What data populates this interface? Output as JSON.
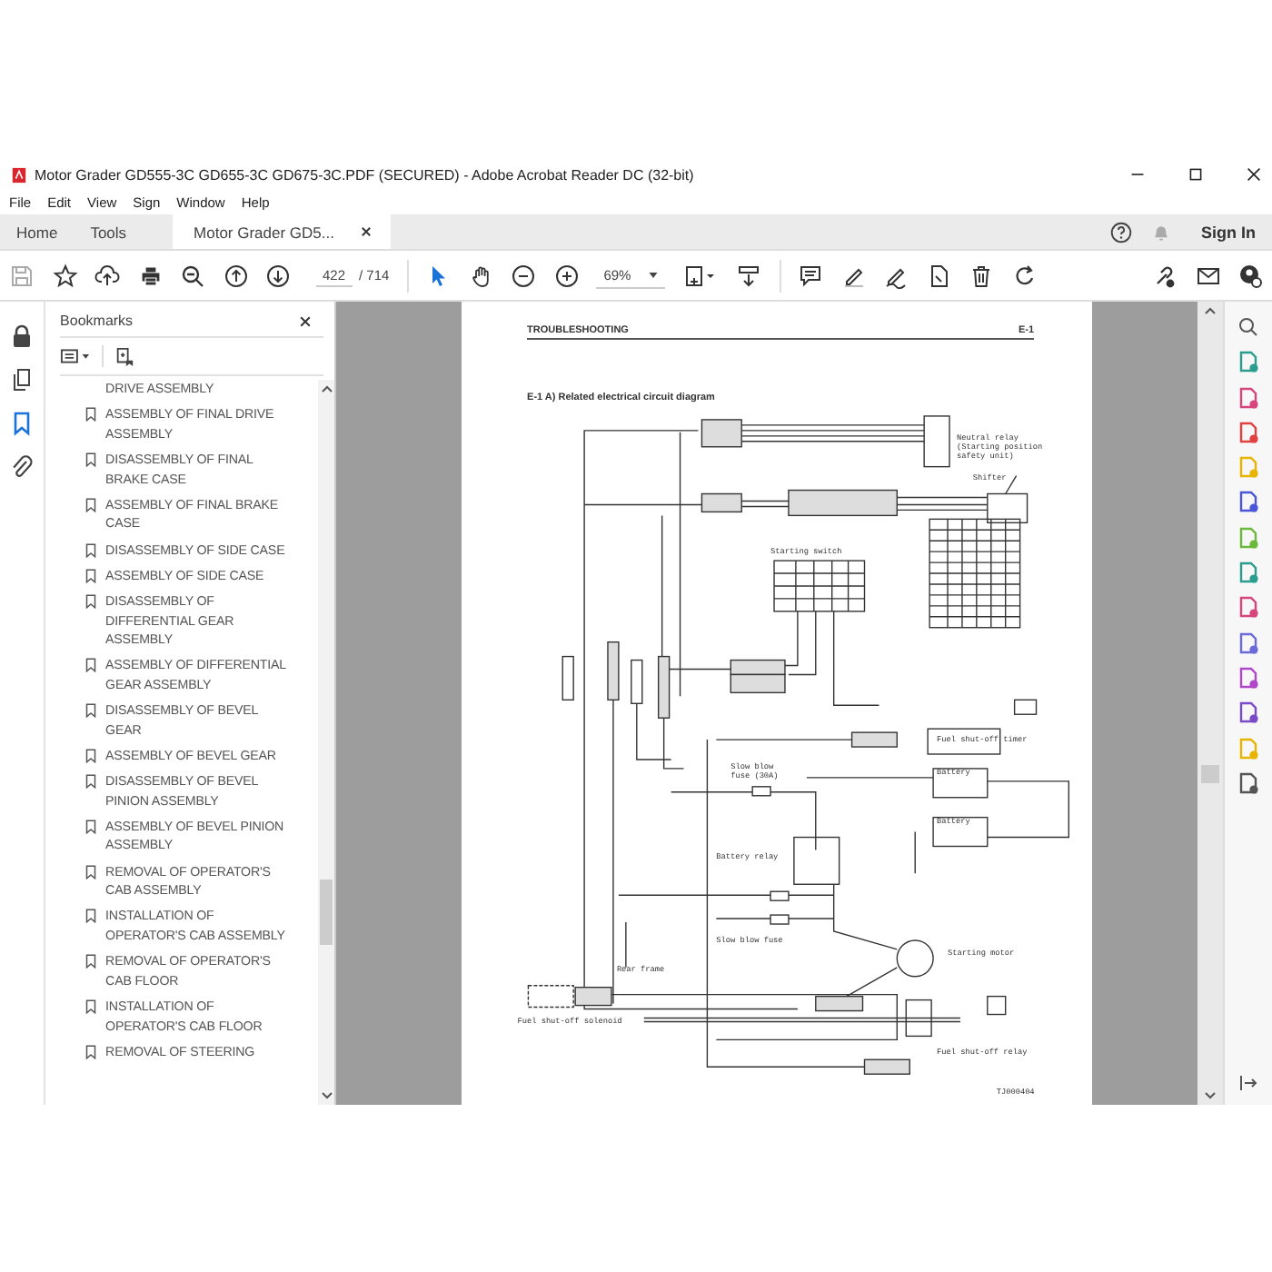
{
  "window": {
    "title": "Motor Grader GD555-3C GD655-3C GD675-3C.PDF (SECURED) - Adobe Acrobat Reader DC (32-bit)"
  },
  "menu": [
    "File",
    "Edit",
    "View",
    "Sign",
    "Window",
    "Help"
  ],
  "tabs": [
    {
      "label": "Home",
      "selected": false,
      "closable": false
    },
    {
      "label": "Tools",
      "selected": false,
      "closable": false
    },
    {
      "label": "Motor Grader GD5...",
      "selected": true,
      "closable": true
    }
  ],
  "account": {
    "sign_in": "Sign In"
  },
  "toolbar": {
    "page_number": "422",
    "page_total": "/ 714",
    "zoom": "69%"
  },
  "side_tools": [
    {
      "kind": "lock",
      "selected": false
    },
    {
      "kind": "pages",
      "selected": false
    },
    {
      "kind": "bookmarks",
      "selected": true
    },
    {
      "kind": "attachments",
      "selected": false
    }
  ],
  "bookmarks": {
    "title": "Bookmarks",
    "items": [
      {
        "label": "DRIVE ASSEMBLY",
        "kind": "continuation"
      },
      {
        "label": "ASSEMBLY OF FINAL DRIVE ASSEMBLY",
        "kind": "bookmark"
      },
      {
        "label": "DISASSEMBLY OF FINAL BRAKE CASE",
        "kind": "bookmark"
      },
      {
        "label": "ASSEMBLY OF FINAL BRAKE CASE",
        "kind": "bookmark"
      },
      {
        "label": "DISASSEMBLY OF SIDE CASE",
        "kind": "bookmark"
      },
      {
        "label": "ASSEMBLY OF SIDE CASE",
        "kind": "bookmark"
      },
      {
        "label": "DISASSEMBLY OF DIFFERENTIAL GEAR ASSEMBLY",
        "kind": "bookmark"
      },
      {
        "label": "ASSEMBLY OF DIFFERENTIAL GEAR ASSEMBLY",
        "kind": "bookmark"
      },
      {
        "label": "DISASSEMBLY OF BEVEL GEAR",
        "kind": "bookmark"
      },
      {
        "label": "ASSEMBLY OF BEVEL GEAR",
        "kind": "bookmark"
      },
      {
        "label": "DISASSEMBLY OF BEVEL PINION ASSEMBLY",
        "kind": "bookmark"
      },
      {
        "label": "ASSEMBLY OF BEVEL PINION ASSEMBLY",
        "kind": "bookmark"
      },
      {
        "label": "REMOVAL OF OPERATOR'S CAB ASSEMBLY",
        "kind": "bookmark"
      },
      {
        "label": "INSTALLATION OF OPERATOR'S CAB ASSEMBLY",
        "kind": "bookmark"
      },
      {
        "label": "REMOVAL OF OPERATOR'S CAB FLOOR",
        "kind": "bookmark"
      },
      {
        "label": "INSTALLATION OF OPERATOR'S CAB FLOOR",
        "kind": "bookmark"
      },
      {
        "label": "REMOVAL OF STEERING",
        "kind": "bookmark"
      }
    ]
  },
  "document": {
    "header_left": "TROUBLESHOOTING",
    "header_right": "E-1",
    "section_title": "E-1 A) Related electrical circuit diagram",
    "diagram_labels": [
      "Neutral relay",
      "(Starting position",
      "safety unit)",
      "Shifter",
      "Starting switch",
      "Fuel shut-off timer",
      "Battery",
      "Battery",
      "Slow blow",
      "fuse (30A)",
      "Battery relay",
      "Slow blow fuse",
      "Starting motor",
      "Rear frame",
      "Fuel shut-off solenoid",
      "Fuel shut-off relay"
    ],
    "figure_id": "TJ000404"
  }
}
